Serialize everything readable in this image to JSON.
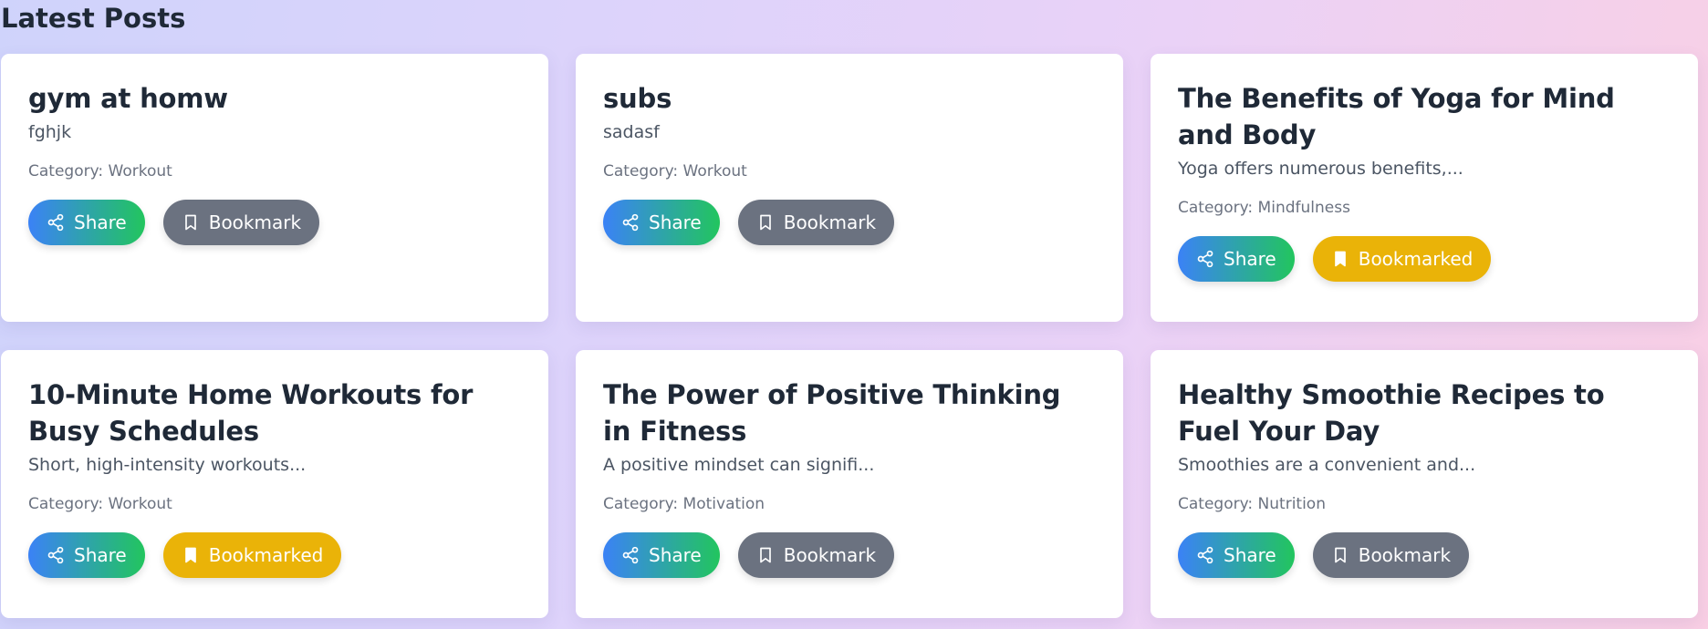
{
  "page": {
    "heading": "Latest Posts"
  },
  "posts": [
    {
      "title": "gym at homw",
      "excerpt": "fghjk",
      "category": "Category: Workout",
      "share_label": "Share",
      "bookmark_label": "Bookmark",
      "bookmarked": false
    },
    {
      "title": "subs",
      "excerpt": "sadasf",
      "category": "Category: Workout",
      "share_label": "Share",
      "bookmark_label": "Bookmark",
      "bookmarked": false
    },
    {
      "title": "The Benefits of Yoga for Mind and Body",
      "excerpt": "Yoga offers numerous benefits,...",
      "category": "Category: Mindfulness",
      "share_label": "Share",
      "bookmark_label": "Bookmarked",
      "bookmarked": true
    },
    {
      "title": "10-Minute Home Workouts for Busy Schedules",
      "excerpt": "Short, high-intensity workouts...",
      "category": "Category: Workout",
      "share_label": "Share",
      "bookmark_label": "Bookmarked",
      "bookmarked": true
    },
    {
      "title": "The Power of Positive Thinking in Fitness",
      "excerpt": "A positive mindset can signifi...",
      "category": "Category: Motivation",
      "share_label": "Share",
      "bookmark_label": "Bookmark",
      "bookmarked": false
    },
    {
      "title": "Healthy Smoothie Recipes to Fuel Your Day",
      "excerpt": "Smoothies are a convenient and...",
      "category": "Category: Nutrition",
      "share_label": "Share",
      "bookmark_label": "Bookmark",
      "bookmarked": false
    }
  ],
  "icons": {
    "share": "share-icon",
    "bookmark": "bookmark-icon",
    "bookmarked": "bookmark-filled-icon"
  },
  "colors": {
    "share_gradient_start": "#3b82f6",
    "share_gradient_end": "#22c55e",
    "bookmark": "#6b7280",
    "bookmarked": "#eab308"
  }
}
